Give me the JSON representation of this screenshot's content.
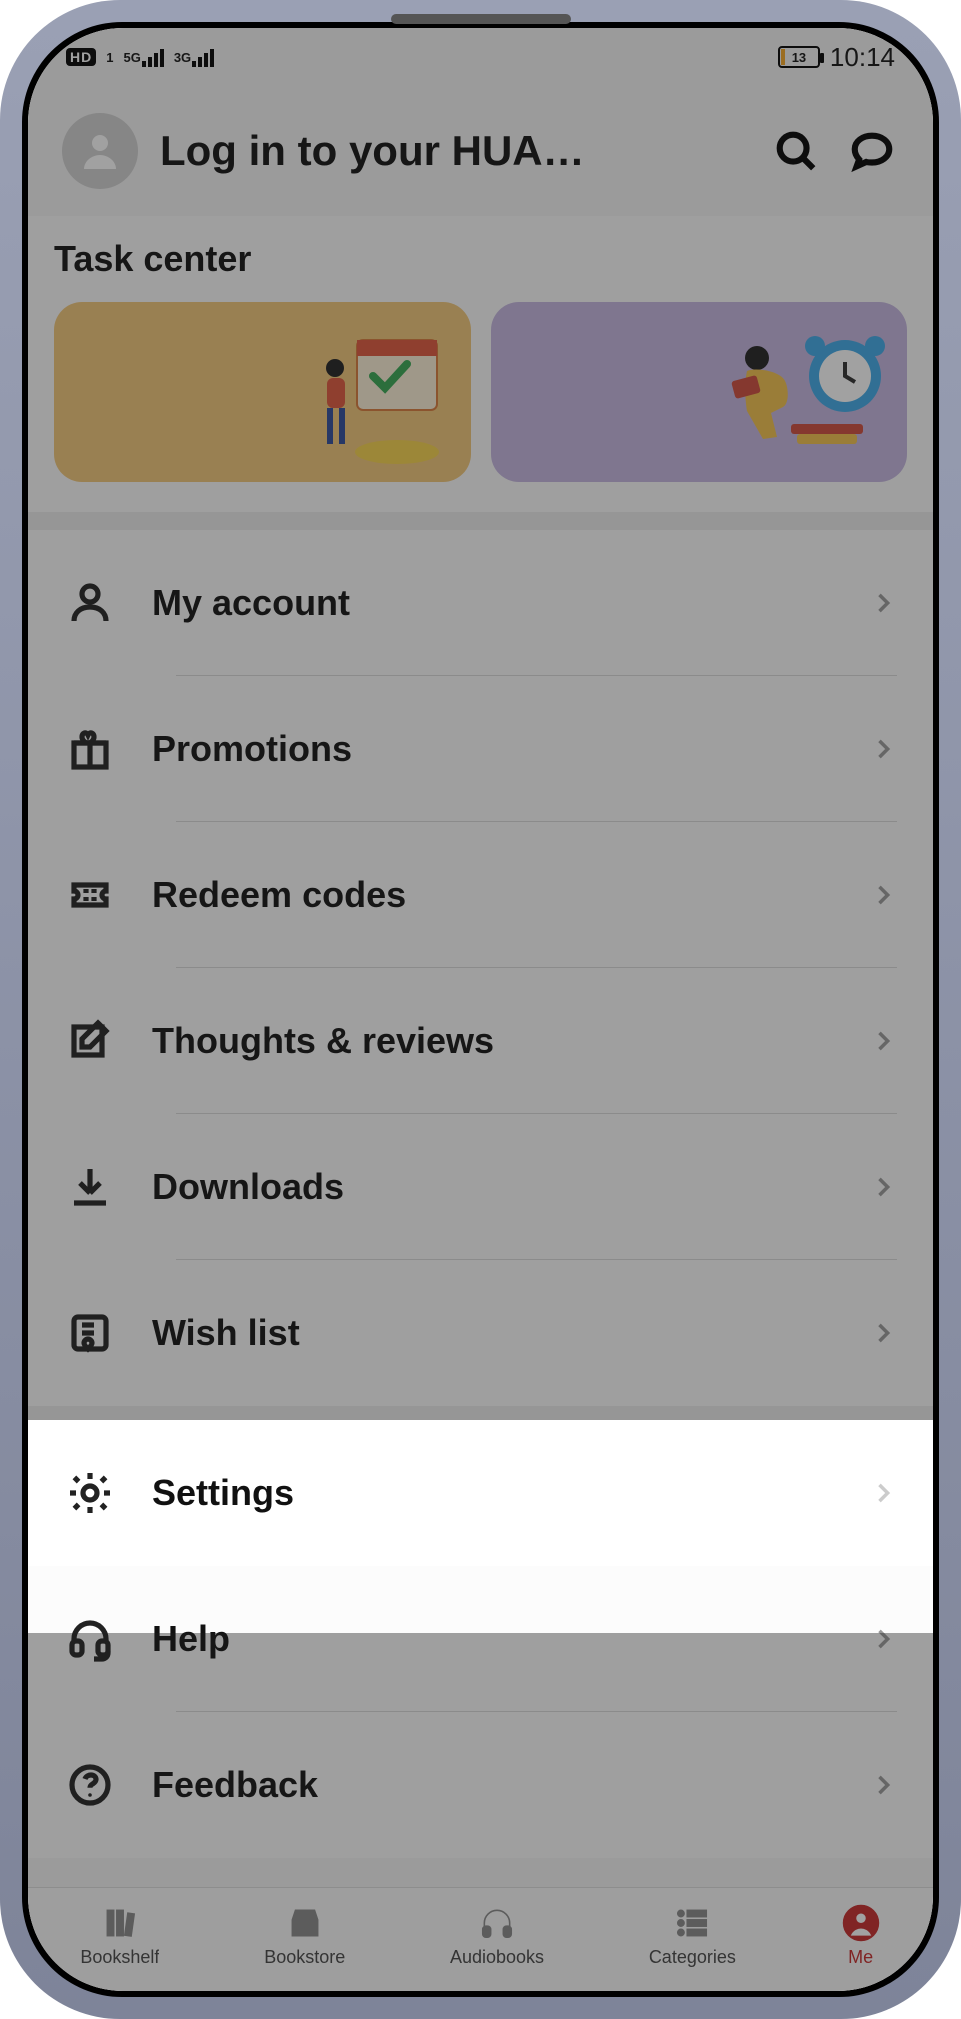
{
  "status_bar": {
    "hd_badge": "HD",
    "hd_sim": "1",
    "net1": "5G",
    "net2": "3G",
    "battery_pct": "13",
    "time": "10:14"
  },
  "header": {
    "title": "Log in to your HUA…"
  },
  "task": {
    "title": "Task center"
  },
  "menu": {
    "items": [
      {
        "label": "My account"
      },
      {
        "label": "Promotions"
      },
      {
        "label": "Redeem codes"
      },
      {
        "label": "Thoughts & reviews"
      },
      {
        "label": "Downloads"
      },
      {
        "label": "Wish list"
      }
    ],
    "settings_label": "Settings",
    "help_label": "Help",
    "feedback_label": "Feedback"
  },
  "nav": {
    "items": [
      {
        "label": "Bookshelf"
      },
      {
        "label": "Bookstore"
      },
      {
        "label": "Audiobooks"
      },
      {
        "label": "Categories"
      },
      {
        "label": "Me"
      }
    ]
  }
}
